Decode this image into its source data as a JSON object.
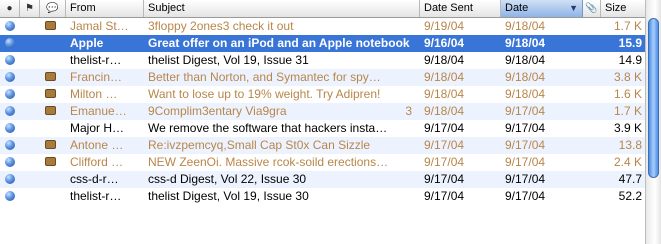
{
  "columns": {
    "from": "From",
    "subject": "Subject",
    "date_sent": "Date Sent",
    "date": "Date",
    "size": "Size"
  },
  "sort": {
    "column": "Date",
    "direction": "descending",
    "arrow": "▼"
  },
  "icons": {
    "header_status": "dot-icon",
    "header_flag": "flag-icon",
    "header_chat": "speech-bubble-icon",
    "header_attachment": "paperclip-icon",
    "row_unread": "unread-dot-icon",
    "row_junk": "junk-mail-icon"
  },
  "colors": {
    "junk_text": "#b8864a",
    "selection": "#3875d7",
    "unread_dot": "#5c93e0"
  },
  "messages": [
    {
      "from": "Jamal St…",
      "subject": "3floppy 2ones3 check it out",
      "count": "",
      "date_sent": "9/19/04",
      "date": "9/18/04",
      "size": "1.7 K",
      "unread": true,
      "junk": true,
      "selected": false
    },
    {
      "from": "Apple",
      "subject": "Great offer on an iPod and an Apple notebook.",
      "count": "",
      "date_sent": "9/16/04",
      "date": "9/18/04",
      "size": "15.9",
      "unread": true,
      "junk": false,
      "selected": true
    },
    {
      "from": "thelist-r…",
      "subject": "thelist Digest, Vol 19, Issue 31",
      "count": "",
      "date_sent": "9/18/04",
      "date": "9/18/04",
      "size": "14.9",
      "unread": true,
      "junk": false,
      "selected": false
    },
    {
      "from": "Francin…",
      "subject": "Better than Norton, and Symantec for spy…",
      "count": "",
      "date_sent": "9/18/04",
      "date": "9/18/04",
      "size": "3.8 K",
      "unread": true,
      "junk": true,
      "selected": false
    },
    {
      "from": "Milton …",
      "subject": "Want to lose up to 19% weight. Try Adipren!",
      "count": "",
      "date_sent": "9/18/04",
      "date": "9/18/04",
      "size": "1.6 K",
      "unread": true,
      "junk": true,
      "selected": false
    },
    {
      "from": "Emanue…",
      "subject": "9Complim3entary Via9gra",
      "count": "3",
      "date_sent": "9/18/04",
      "date": "9/17/04",
      "size": "1.7 K",
      "unread": true,
      "junk": true,
      "selected": false
    },
    {
      "from": "Major H…",
      "subject": "We remove the software that hackers insta…",
      "count": "",
      "date_sent": "9/17/04",
      "date": "9/17/04",
      "size": "3.9 K",
      "unread": true,
      "junk": false,
      "selected": false
    },
    {
      "from": "Antone …",
      "subject": "Re:ivzpemcyq,Small Cap St0x Can Sizzle",
      "count": "",
      "date_sent": "9/17/04",
      "date": "9/17/04",
      "size": "13.8",
      "unread": true,
      "junk": true,
      "selected": false
    },
    {
      "from": "Clifford …",
      "subject": "NEW ZeenOi. Massive rcok-soild erections…",
      "count": "",
      "date_sent": "9/17/04",
      "date": "9/17/04",
      "size": "2.4 K",
      "unread": true,
      "junk": true,
      "selected": false
    },
    {
      "from": "css-d-r…",
      "subject": "css-d Digest, Vol 22, Issue 30",
      "count": "",
      "date_sent": "9/17/04",
      "date": "9/17/04",
      "size": "47.7",
      "unread": true,
      "junk": false,
      "selected": false
    },
    {
      "from": "thelist-r…",
      "subject": "thelist Digest, Vol 19, Issue 30",
      "count": "",
      "date_sent": "9/17/04",
      "date": "9/17/04",
      "size": "52.2",
      "unread": true,
      "junk": false,
      "selected": false
    }
  ]
}
